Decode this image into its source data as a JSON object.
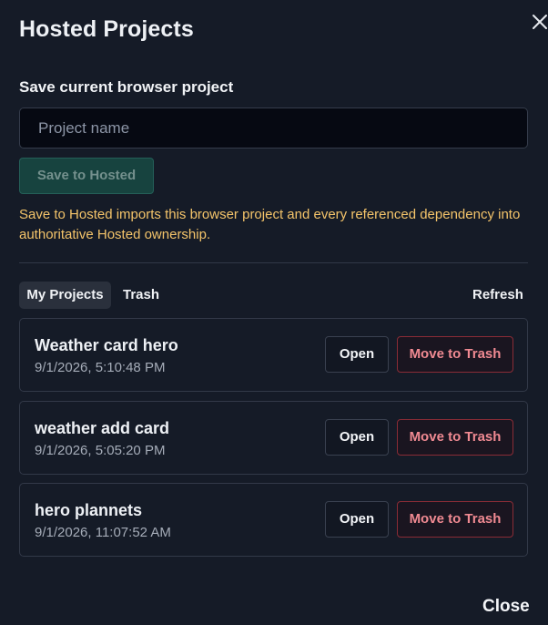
{
  "dialog": {
    "title": "Hosted Projects",
    "close_label": "Close"
  },
  "save_section": {
    "label": "Save current browser project",
    "input_placeholder": "Project name",
    "input_value": "",
    "save_button_label": "Save to Hosted",
    "notice": "Save to Hosted imports this browser project and every referenced dependency into authoritative Hosted ownership."
  },
  "tabs": [
    {
      "label": "My Projects",
      "active": true
    },
    {
      "label": "Trash",
      "active": false
    }
  ],
  "refresh_label": "Refresh",
  "projects": [
    {
      "name": "Weather card hero",
      "date": "9/1/2026, 5:10:48 PM",
      "open_label": "Open",
      "trash_label": "Move to Trash"
    },
    {
      "name": "weather add card",
      "date": "9/1/2026, 5:05:20 PM",
      "open_label": "Open",
      "trash_label": "Move to Trash"
    },
    {
      "name": "hero plannets",
      "date": "9/1/2026, 11:07:52 AM",
      "open_label": "Open",
      "trash_label": "Move to Trash"
    }
  ],
  "colors": {
    "background": "#151b27",
    "accent_notice": "#f4c46a",
    "save_button_bg": "#17433f",
    "danger_text": "#f08a92",
    "danger_border": "#8a2c36"
  },
  "icons": {
    "close": "close-icon"
  }
}
